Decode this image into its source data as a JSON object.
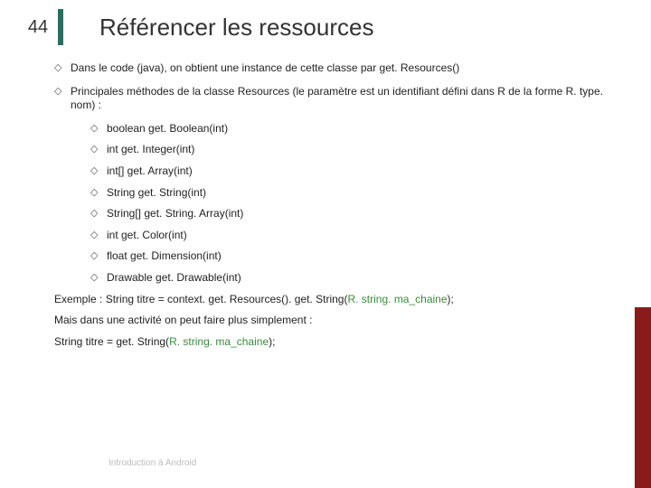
{
  "page_number": "44",
  "title": "Référencer les ressources",
  "bullets": [
    "Dans le code (java), on obtient une instance de cette classe par get. Resources()",
    "Principales méthodes de la classe Resources (le paramètre est un identifiant défini dans R de la forme R. type. nom) :"
  ],
  "sub_bullets": [
    "boolean get. Boolean(int)",
    "int get. Integer(int)",
    "int[] get. Array(int)",
    "String get. String(int)",
    "String[] get. String. Array(int)",
    "int get. Color(int)",
    "float get. Dimension(int)",
    "Drawable get. Drawable(int)"
  ],
  "example": {
    "prefix": "Exemple : String titre = context. get. Resources(). get. String(",
    "green": "R. string. ma_chaine",
    "suffix": ");"
  },
  "note": "Mais dans une activité on peut faire plus simplement :",
  "example2": {
    "prefix": "String titre = get. String(",
    "green": "R. string. ma_chaine",
    "suffix": ");"
  },
  "footer": "Introduction à Android"
}
